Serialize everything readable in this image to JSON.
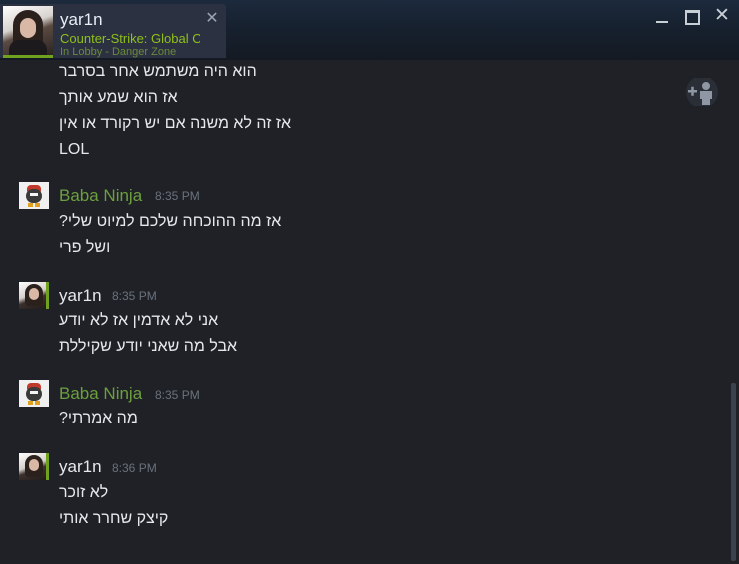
{
  "tab": {
    "name": "yar1n",
    "game": "Counter-Strike: Global Offensive",
    "status": "In Lobby - Danger Zone"
  },
  "window_controls": {
    "minimize": "",
    "maximize": "",
    "close": "✕"
  },
  "tab_close": "✕",
  "intro_lines": [
    "הוא היה משתמש אחר בסרבר",
    "אז הוא שמע אותך",
    "אז זה לא משנה אם יש רקורד או אין",
    "LOL"
  ],
  "messages": [
    {
      "sender": "Baba Ninja",
      "time": "8:35 PM",
      "lines": [
        "?אז מה ההוכחה שלכם למיוט שלי",
        "ושל פרי"
      ]
    },
    {
      "sender": "yar1n",
      "time": "8:35 PM",
      "lines": [
        "אני לא אדמין אז לא יודע",
        "אבל מה שאני יודע שקיללת"
      ]
    },
    {
      "sender": "Baba Ninja",
      "time": "8:35 PM",
      "lines": [
        "?מה אמרתי"
      ]
    },
    {
      "sender": "yar1n",
      "time": "8:36 PM",
      "lines": [
        "לא זוכר",
        "קיצק שחרר אותי"
      ]
    }
  ],
  "icons": {
    "invite": "add-friend-icon",
    "ninja_avatar": "ninja-avatar-icon",
    "self_avatar": "user-avatar-icon"
  },
  "colors": {
    "friend_name": "#6d9f3f",
    "game_green": "#8fc01a",
    "background": "#1f2126"
  }
}
